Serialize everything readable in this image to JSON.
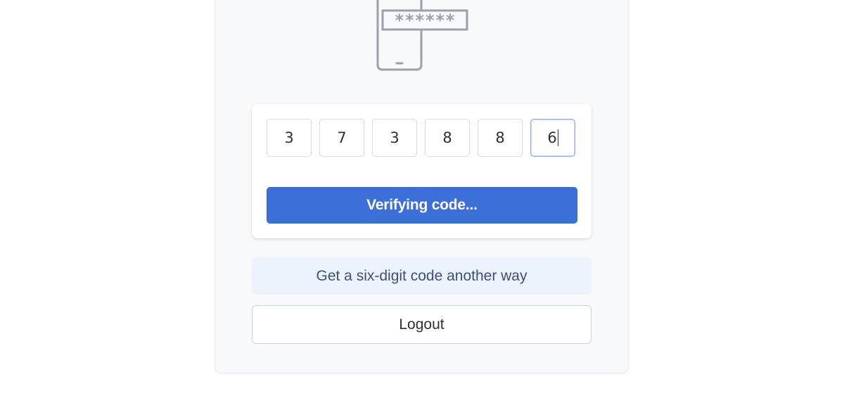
{
  "illustration": {
    "icon": "phone-with-password-icon",
    "masked_code": "******"
  },
  "code_entry": {
    "digits": [
      "3",
      "7",
      "3",
      "8",
      "8",
      "6"
    ],
    "focused_index": 5
  },
  "verify_button": {
    "label": "Verifying code..."
  },
  "alternate_method": {
    "label": "Get a six-digit code another way"
  },
  "logout_button": {
    "label": "Logout"
  },
  "colors": {
    "primary": "#3d6fd8",
    "link_bg": "#edf3fd",
    "panel_bg": "#f8f9fb",
    "illustration_stroke": "#9aa1ab"
  }
}
